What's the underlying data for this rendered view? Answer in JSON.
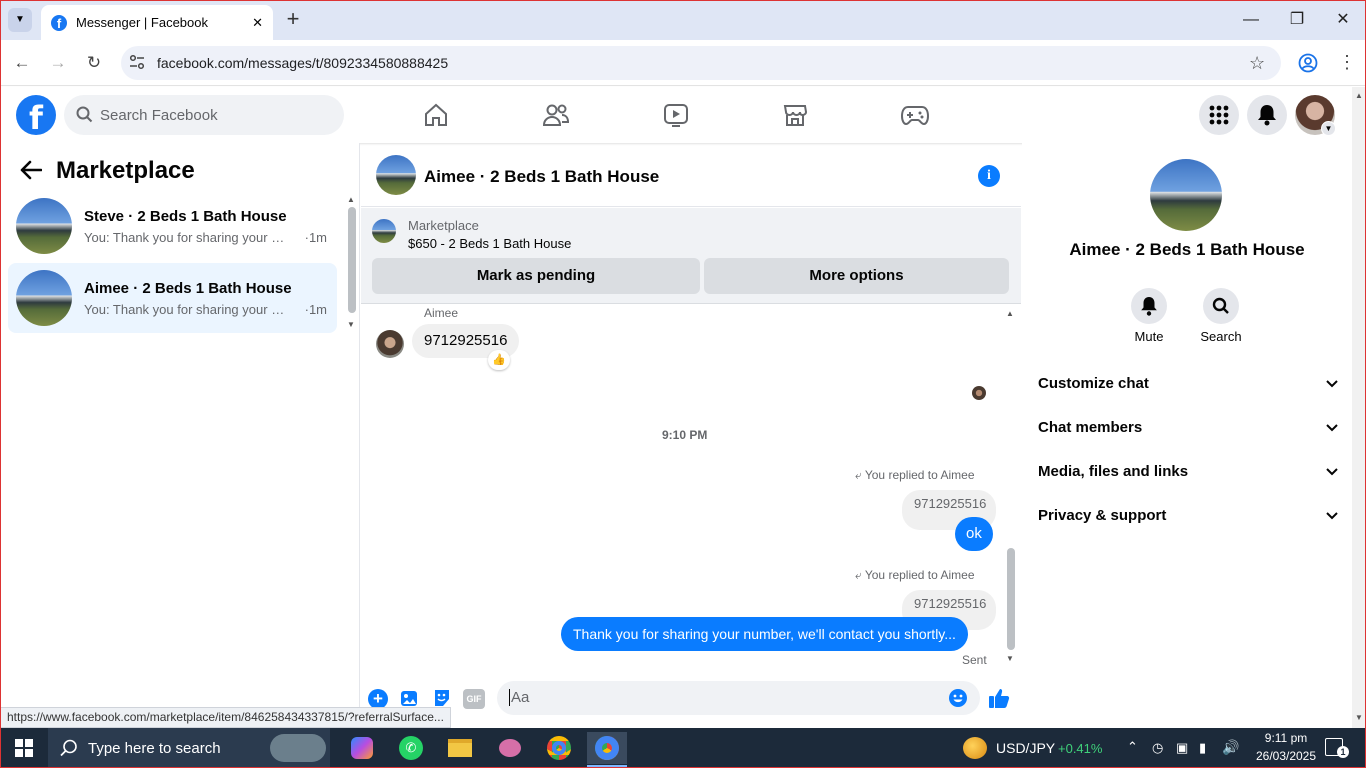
{
  "browser": {
    "tab_title": "Messenger | Facebook",
    "favicon": "f",
    "url": "facebook.com/messages/t/8092334580888425",
    "new_tab": "+",
    "close_tab": "✕"
  },
  "facebook": {
    "logo": "f",
    "search_placeholder": "Search Facebook"
  },
  "left_panel": {
    "title": "Marketplace",
    "conversations": [
      {
        "name": "Steve · 2 Beds 1 Bath House",
        "preview": "You: Thank you for sharing your n...",
        "time": "·1m",
        "active": false
      },
      {
        "name": "Aimee · 2 Beds 1 Bath House",
        "preview": "You: Thank you for sharing your n...",
        "time": "·1m",
        "active": true
      }
    ]
  },
  "chat": {
    "title": "Aimee · 2 Beds 1 Bath House",
    "info_icon": "i",
    "listing": {
      "label": "Marketplace",
      "price_title": "$650 - 2 Beds 1 Bath House",
      "btn_pending": "Mark as pending",
      "btn_more": "More options"
    },
    "messages": {
      "sender_name": "Aimee",
      "incoming_text": "9712925516",
      "reaction": "👍",
      "timestamp": "9:10 PM",
      "reply1_label": "You replied to Aimee",
      "reply1_quote": "9712925516",
      "reply1_text": "ok",
      "reply2_label": "You replied to Aimee",
      "reply2_quote": "9712925516",
      "reply2_text": "Thank you for sharing your number, we'll contact you shortly...",
      "status": "Sent"
    },
    "composer": {
      "placeholder": "Aa",
      "gif": "GIF"
    }
  },
  "right_panel": {
    "title": "Aimee · 2 Beds 1 Bath House",
    "mute_label": "Mute",
    "search_label": "Search",
    "sections": [
      "Customize chat",
      "Chat members",
      "Media, files and links",
      "Privacy & support"
    ]
  },
  "status_url": "https://www.facebook.com/marketplace/item/846258434337815/?referralSurface...",
  "taskbar": {
    "search_placeholder": "Type here to search",
    "ticker": "USD/JPY",
    "ticker_change": "+0.41%",
    "time": "9:11 pm",
    "date": "26/03/2025",
    "notif_count": "1"
  },
  "colors": {
    "fb_blue": "#1877f2",
    "messenger_blue": "#0a7cff",
    "positive": "#3fd17a"
  }
}
